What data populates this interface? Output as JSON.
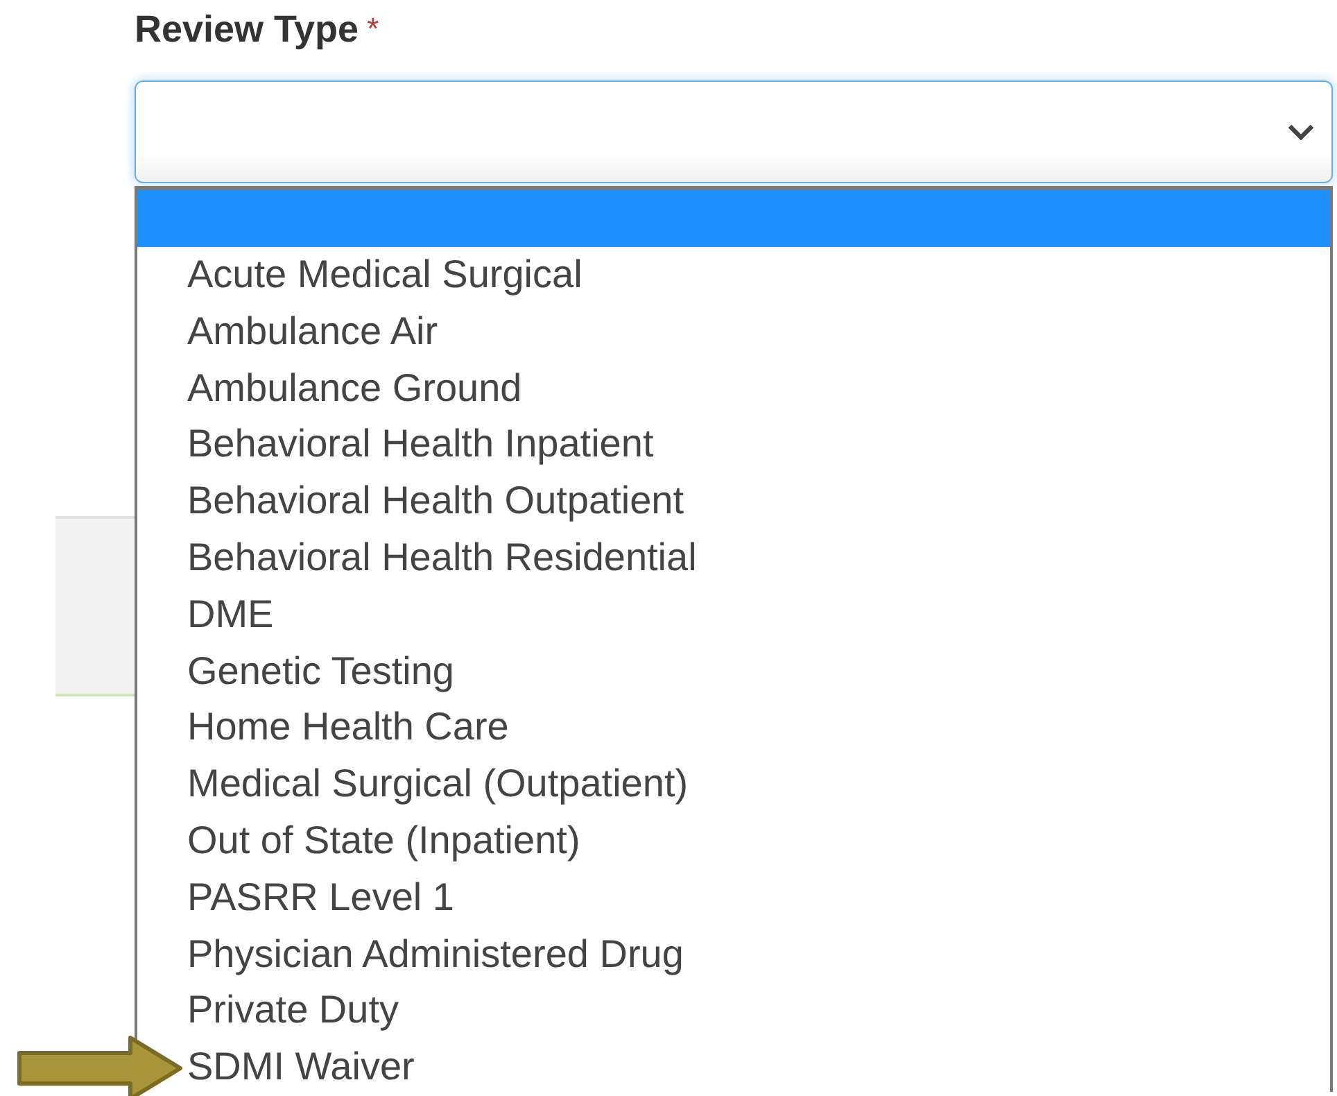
{
  "field": {
    "label": "Review Type",
    "required_mark": "*"
  },
  "dropdown": {
    "expanded": true,
    "blank_option": {
      "selected": true
    },
    "options": [
      {
        "label": "Acute Medical Surgical",
        "selected": false,
        "pointed": false
      },
      {
        "label": "Ambulance Air",
        "selected": false,
        "pointed": false
      },
      {
        "label": "Ambulance Ground",
        "selected": false,
        "pointed": false
      },
      {
        "label": "Behavioral Health Inpatient",
        "selected": false,
        "pointed": false
      },
      {
        "label": "Behavioral Health Outpatient",
        "selected": false,
        "pointed": false
      },
      {
        "label": "Behavioral Health Residential",
        "selected": false,
        "pointed": false
      },
      {
        "label": "DME",
        "selected": false,
        "pointed": false
      },
      {
        "label": "Genetic Testing",
        "selected": false,
        "pointed": false
      },
      {
        "label": "Home Health Care",
        "selected": false,
        "pointed": false
      },
      {
        "label": "Medical Surgical (Outpatient)",
        "selected": false,
        "pointed": false
      },
      {
        "label": "Out of State (Inpatient)",
        "selected": false,
        "pointed": false
      },
      {
        "label": "PASRR Level 1",
        "selected": false,
        "pointed": false
      },
      {
        "label": "Physician Administered Drug",
        "selected": false,
        "pointed": false
      },
      {
        "label": "Private Duty",
        "selected": false,
        "pointed": false
      },
      {
        "label": "SDMI Waiver",
        "selected": false,
        "pointed": true
      }
    ]
  }
}
